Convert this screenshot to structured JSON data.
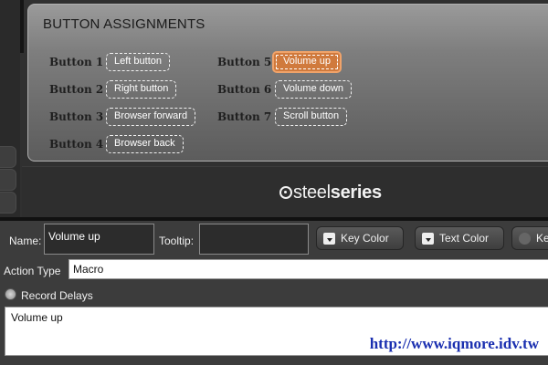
{
  "assignments": {
    "title": "BUTTON ASSIGNMENTS",
    "buttons": [
      {
        "label": "Button 1",
        "value": "Left button"
      },
      {
        "label": "Button 2",
        "value": "Right button"
      },
      {
        "label": "Button 3",
        "value": "Browser forward"
      },
      {
        "label": "Button 4",
        "value": "Browser back"
      },
      {
        "label": "Button 5",
        "value": "Volume up"
      },
      {
        "label": "Button 6",
        "value": "Volume down"
      },
      {
        "label": "Button 7",
        "value": "Scroll button"
      }
    ],
    "selected": "Button 5"
  },
  "brand": {
    "logo_light": "steel",
    "logo_bold": "series"
  },
  "editor": {
    "name_label": "Name:",
    "name_value": "Volume up",
    "tooltip_label": "Tooltip:",
    "tooltip_value": "",
    "key_color_label": "Key Color",
    "text_color_label": "Text Color",
    "third_button_label": "Ke",
    "action_type_label": "Action Type",
    "action_type_value": "Macro",
    "record_delays_label": "Record Delays",
    "macro_text": "Volume up"
  },
  "watermark": "http://www.iqmore.idv.tw",
  "colors": {
    "selected_accent": "#d07a3d",
    "watermark": "#1a2fb0"
  }
}
